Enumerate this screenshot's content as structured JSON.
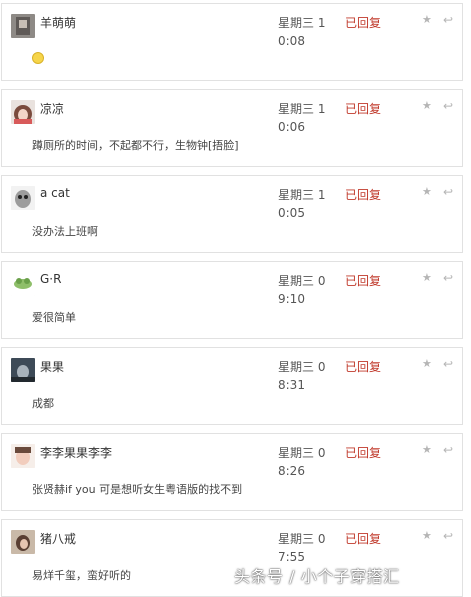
{
  "messages": [
    {
      "name": "羊萌萌",
      "date": "星期三 1",
      "time": "0:08",
      "status": "已回复",
      "text": "",
      "has_emoji": true
    },
    {
      "name": "凉凉",
      "date": "星期三 1",
      "time": "0:06",
      "status": "已回复",
      "text": "蹲厕所的时间，不起都不行，生物钟[捂脸]"
    },
    {
      "name": "a cat",
      "date": "星期三 1",
      "time": "0:05",
      "status": "已回复",
      "text": "没办法上班啊"
    },
    {
      "name": "G·R",
      "date": "星期三 0",
      "time": "9:10",
      "status": "已回复",
      "text": "爱很简单"
    },
    {
      "name": "果果",
      "date": "星期三 0",
      "time": "8:31",
      "status": "已回复",
      "text": "成都"
    },
    {
      "name": "李李果果李李",
      "date": "星期三 0",
      "time": "8:26",
      "status": "已回复",
      "text": "张贤赫if you 可是想听女生粤语版的找不到"
    },
    {
      "name": "猪八戒",
      "date": "星期三 0",
      "time": "7:55",
      "status": "已回复",
      "text": "易烊千玺，蛮好听的"
    }
  ],
  "icons": {
    "star": "star-icon",
    "reply": "reply-arrow-icon"
  },
  "watermark": "头条号 / 小个子穿搭汇",
  "colors": {
    "status": "#c0392b",
    "border": "#e1e1e1",
    "icon": "#b5b5b5"
  }
}
